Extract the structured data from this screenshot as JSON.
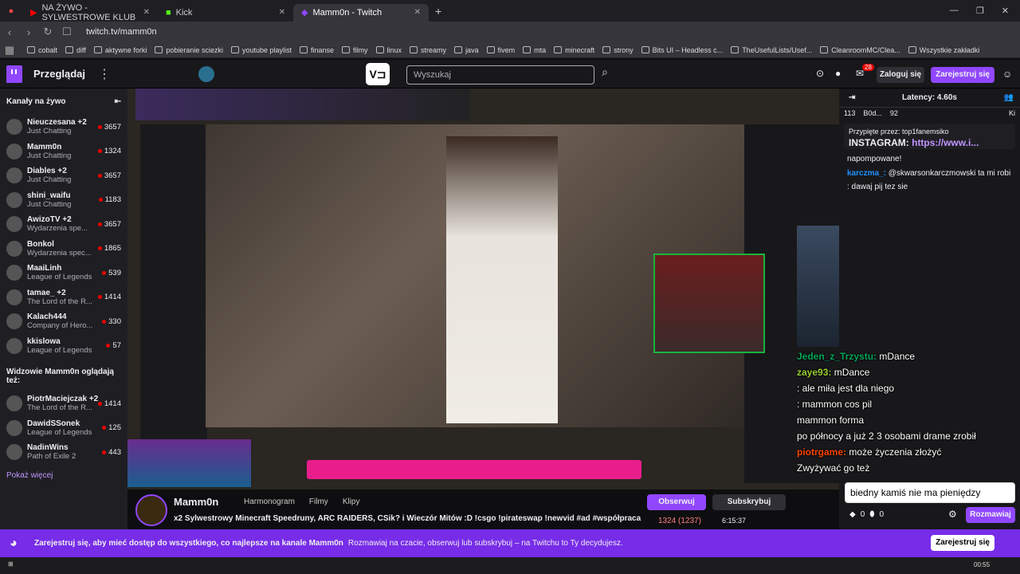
{
  "tabs": [
    {
      "label": "NA ŻYWO - SYLWESTROWE KLUB",
      "active": false
    },
    {
      "label": "Kick",
      "active": false
    },
    {
      "label": "Mamm0n - Twitch",
      "active": true
    }
  ],
  "address": {
    "url": "twitch.tv/mamm0n"
  },
  "bookmarks": [
    "cobalt",
    "diff",
    "aktywne forki",
    "pobieranie sciezki",
    "youtube playlist",
    "finanse",
    "filmy",
    "linux",
    "streamy",
    "java",
    "fivem",
    "mta",
    "minecraft",
    "strony",
    "Bits UI – Headless c...",
    "TheUsefulLists/Usef...",
    "CleanroomMC/Clea...",
    "Wszystkie zakładki"
  ],
  "topnav": {
    "browse": "Przeglądaj",
    "search_placeholder": "Wyszukaj",
    "login": "Zaloguj się",
    "signup": "Zarejestruj się",
    "notif_count": "28"
  },
  "sidebar": {
    "header": "Kanały na żywo",
    "channels": [
      {
        "name": "Nieuczesana +2",
        "game": "Just Chatting",
        "viewers": "3657"
      },
      {
        "name": "Mamm0n",
        "game": "Just Chatting",
        "viewers": "1324"
      },
      {
        "name": "Diables +2",
        "game": "Just Chatting",
        "viewers": "3657"
      },
      {
        "name": "shini_waifu",
        "game": "Just Chatting",
        "viewers": "1183"
      },
      {
        "name": "AwizoTV +2",
        "game": "Wydarzenia spe...",
        "viewers": "3657"
      },
      {
        "name": "Bonkol",
        "game": "Wydarzenia spec...",
        "viewers": "1865"
      },
      {
        "name": "MaaiLinh",
        "game": "League of Legends",
        "viewers": "539"
      },
      {
        "name": "tamae_ +2",
        "game": "The Lord of the R...",
        "viewers": "1414"
      },
      {
        "name": "Kalach444",
        "game": "Company of Hero...",
        "viewers": "330"
      },
      {
        "name": "kkislowa",
        "game": "League of Legends",
        "viewers": "57"
      }
    ],
    "also_header": "Widzowie Mamm0n oglądają też:",
    "also": [
      {
        "name": "PiotrMaciejczak +2",
        "game": "The Lord of the R...",
        "viewers": "1414"
      },
      {
        "name": "DawidSSonek",
        "game": "League of Legends",
        "viewers": "125"
      },
      {
        "name": "NadinWins",
        "game": "Path of Exile 2",
        "viewers": "443"
      }
    ],
    "more": "Pokaż więcej"
  },
  "chat": {
    "latency": "Latency: 4.60s",
    "pinned_by": "Przypięte przez: top1fanemsiko",
    "pinned_text": "INSTAGRAM: ",
    "pinned_link": "https://www.i...",
    "messages": [
      {
        "user": "",
        "text": "napompowane!",
        "cls": ""
      },
      {
        "user": "karczma_:",
        "text": "@skwarsonkarczmowski ta mi robi",
        "cls": "u1"
      },
      {
        "user": "",
        "text": ": dawaj pij tez sie",
        "cls": ""
      }
    ],
    "overlay": [
      {
        "user": "Jeden_z_Trzystu:",
        "text": "mDance",
        "cls": "u3"
      },
      {
        "user": "zaye93:",
        "text": "mDance",
        "cls": "u4"
      },
      {
        "user": "",
        "text": ": ale miła jest dla niego",
        "cls": "u2"
      },
      {
        "user": "",
        "text": ": mammon cos pil",
        "cls": "u2"
      },
      {
        "user": "",
        "text": "mammon forma",
        "cls": "u2"
      },
      {
        "user": "",
        "text": "po północy a już 2 3 osobami drame zrobił",
        "cls": ""
      },
      {
        "user": "piotrgame:",
        "text": "może życzenia złożyć",
        "cls": "u2"
      },
      {
        "user": "",
        "text": "Zwyżywać go też",
        "cls": ""
      },
      {
        "user": "",
        "text": "biedny kamiś nie ma pieniędzy",
        "cls": ""
      }
    ],
    "stats": [
      "113",
      "B0d...",
      "92",
      "Ki"
    ],
    "talk": "Rozmawiaj",
    "points": [
      "0",
      "0"
    ]
  },
  "stream": {
    "name": "Mamm0n",
    "tabs": [
      "Harmonogram",
      "Filmy",
      "Klipy"
    ],
    "title": "x2 Sylwestrowy Minecraft Speedruny, ARC RAIDERS, CSik? i Wieczór Mitów :D !csgo !pirateswap !newvid #ad #współpraca",
    "follow": "Obserwuj",
    "subscribe": "Subskrybuj",
    "viewers": "1324 (1237)",
    "uptime": "6:15:37"
  },
  "banner": {
    "bold": "Zarejestruj się, aby mieć dostęp do wszystkiego, co najlepsze na kanale Mamm0n",
    "sub": "Rozmawiaj na czacie, obserwuj lub subskrybuj – na Twitchu to Ty decydujesz.",
    "button": "Zarejestruj się"
  },
  "taskbar": {
    "time": "00:55"
  },
  "colors": {
    "accent": "#9147ff",
    "live": "#eb0400"
  }
}
